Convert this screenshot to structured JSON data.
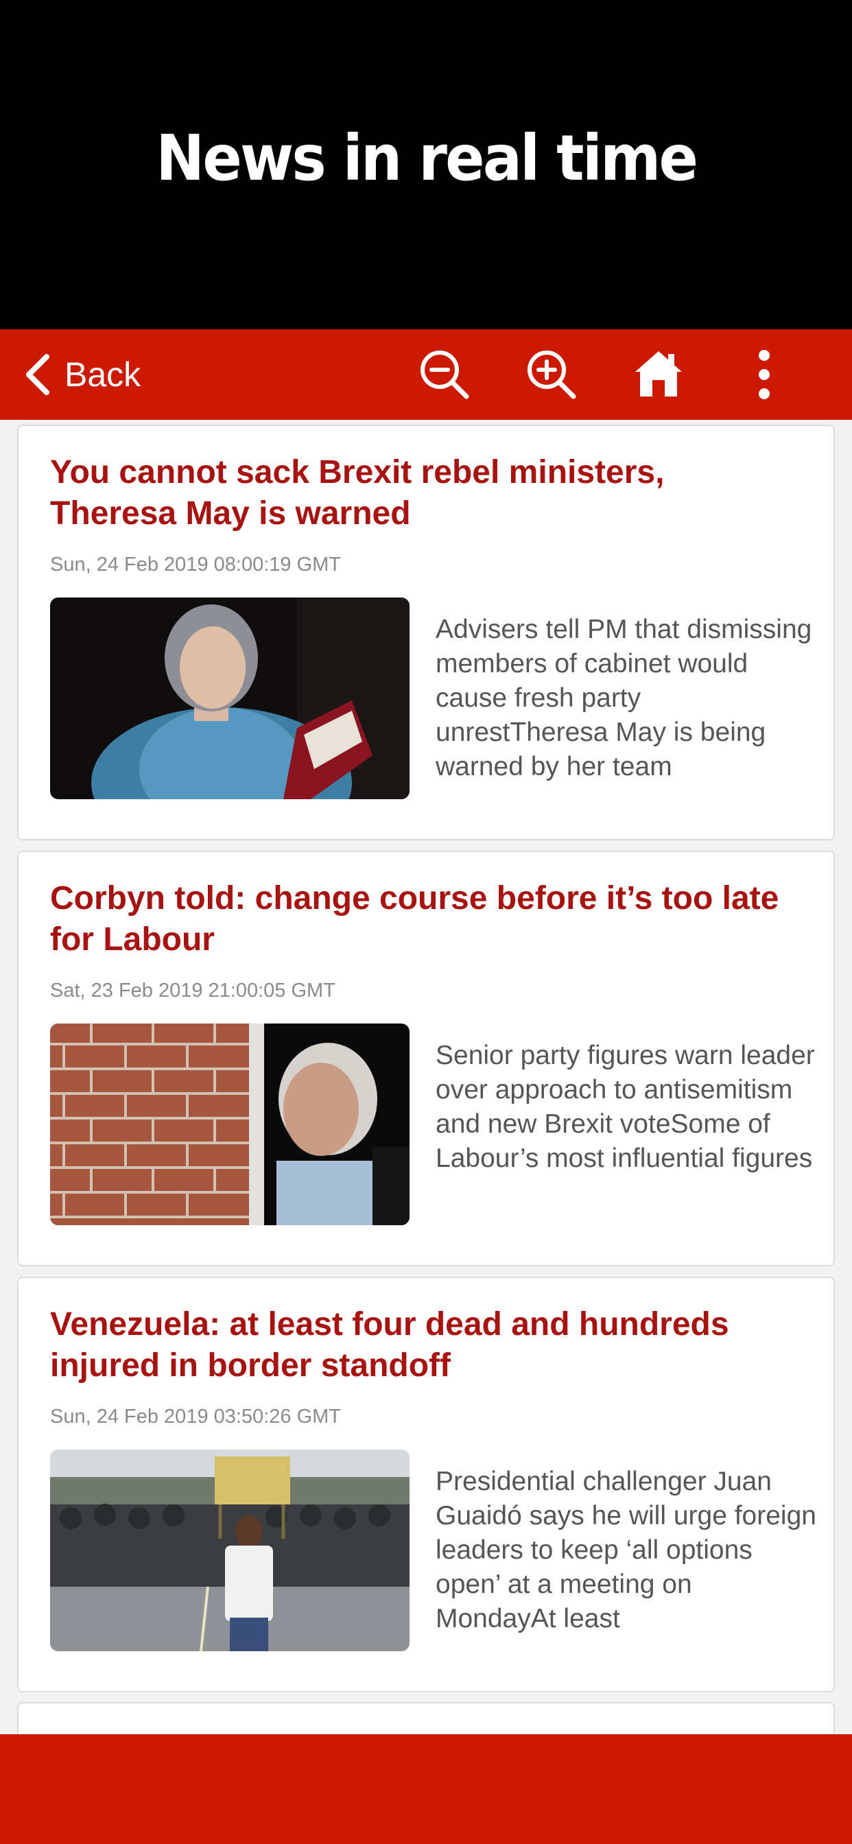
{
  "promo": {
    "title": "News in real time"
  },
  "toolbar": {
    "back_label": "Back",
    "icons": [
      "zoom-out-icon",
      "zoom-in-icon",
      "home-icon",
      "more-vertical-icon"
    ],
    "color": "#cc1a00"
  },
  "articles": [
    {
      "title": "You cannot sack Brexit rebel ministers, Theresa May is warned",
      "date": "Sun, 24 Feb 2019 08:00:19 GMT",
      "excerpt": "Advisers tell PM that dismissing members of cabinet would cause fresh party unrestTheresa May is being warned by her team",
      "image": "photo-theresa-may"
    },
    {
      "title": "Corbyn told: change course before it’s too late for Labour",
      "date": "Sat, 23 Feb 2019 21:00:05 GMT",
      "excerpt": "Senior party figures warn leader over approach to antisemitism and new Brexit voteSome of Labour’s most influential figures",
      "image": "photo-jeremy-corbyn"
    },
    {
      "title": "Venezuela: at least four dead and hundreds injured in border standoff",
      "date": "Sun, 24 Feb 2019 03:50:26 GMT",
      "excerpt": "Presidential challenger Juan Guaidó says he will urge foreign leaders to keep ‘all options open’ at a meeting on MondayAt least",
      "image": "photo-venezuela-border"
    }
  ],
  "colors": {
    "accent": "#cc1a00",
    "title": "#a61310",
    "date": "#8a8a8a",
    "excerpt": "#555555"
  }
}
